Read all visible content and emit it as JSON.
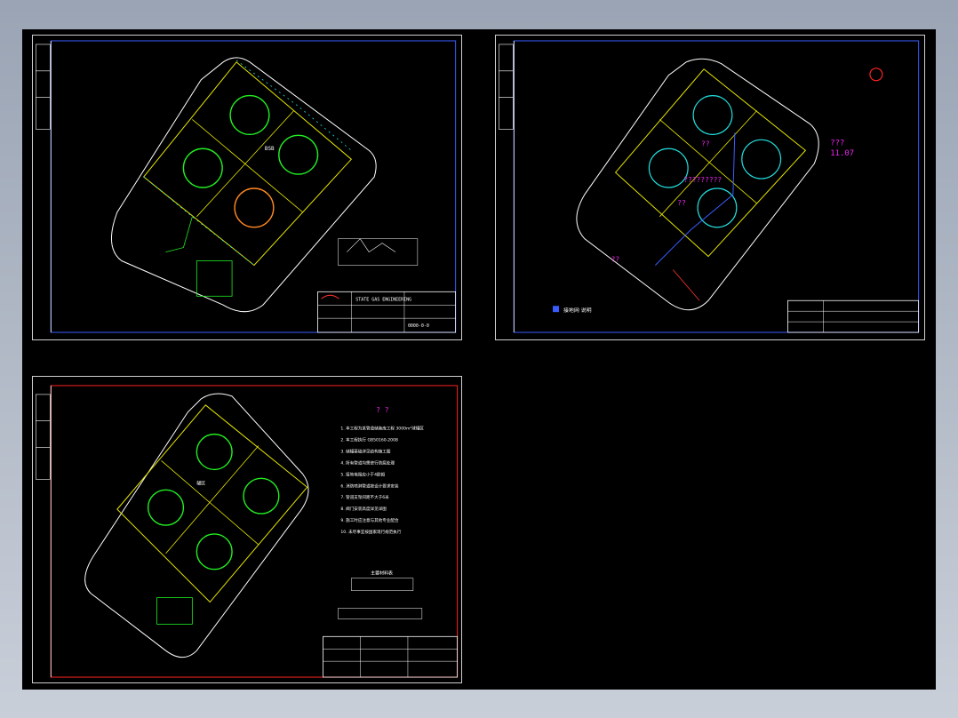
{
  "app": {
    "background_color": "#000000",
    "frame_color": "#cfcfcf"
  },
  "sheet1": {
    "boundary_label": "BSB",
    "title_block_company": "STATE GAS ENGINEERING",
    "drawing_no": "0000-0-0"
  },
  "sheet2": {
    "annotation_q1": "??",
    "annotation_q2": "???",
    "annotation_q3": "?????????",
    "annotation_q4": "??",
    "annotation_q5": "??",
    "elevation_text": "11.07",
    "legend_text": "接地网 说明"
  },
  "sheet3": {
    "notes_title": "? ?",
    "notes": [
      "1. 本工程为某管道储备库工程 3000m³球罐区",
      "2. 本工程执行 GB50160-2008",
      "3. 储罐基础详见结构施工图",
      "4. 所有管道均需进行防腐处理",
      "5. 接地电阻应小于4欧姆",
      "6. 消防喷淋管道按设计要求安装",
      "7. 管道支架间距不大于6米",
      "8. 阀门安装高度详见详图",
      "9. 施工时应注意与其他专业配合",
      "10. 未尽事宜按国家现行规范执行"
    ],
    "table_title": "主要材料表",
    "area_label": "罐区"
  }
}
